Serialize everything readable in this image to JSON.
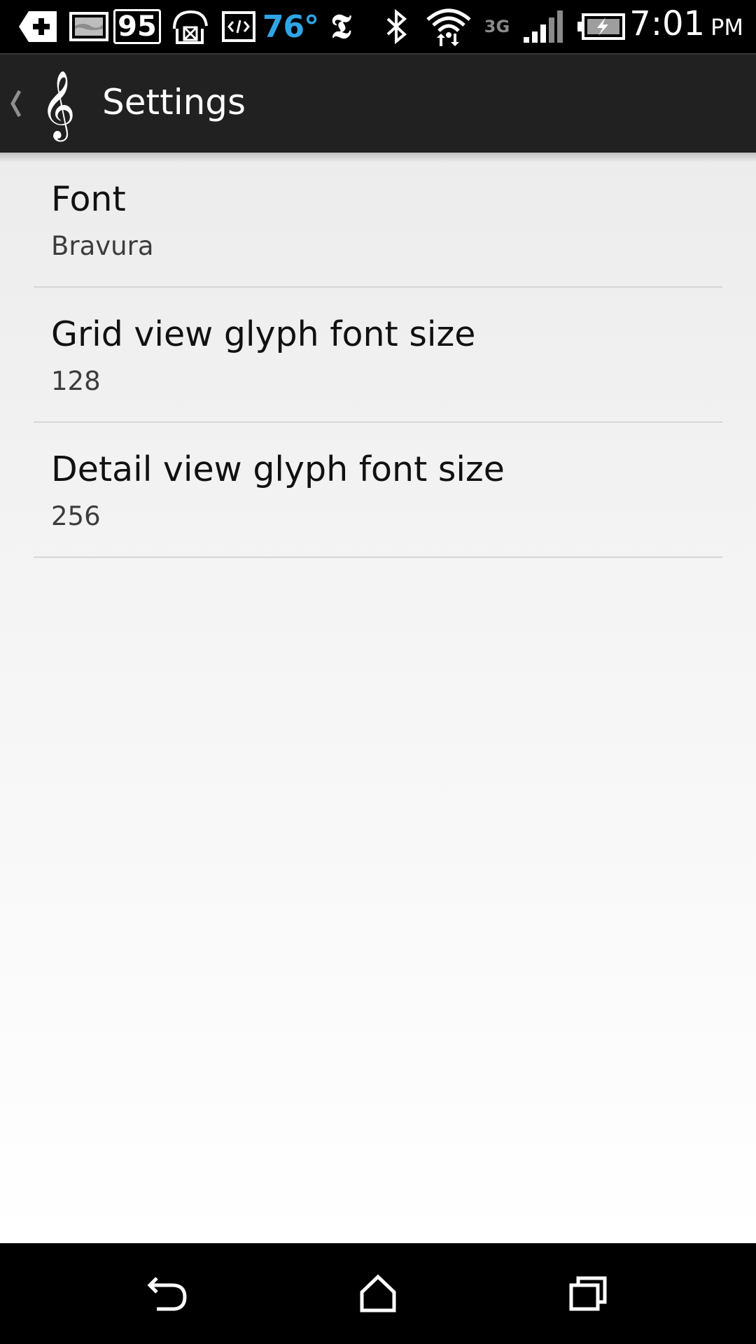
{
  "status_bar": {
    "icons": [
      "health-plus-icon",
      "photo-icon",
      "notification-count-badge",
      "image-download-icon",
      "code-icon",
      "temperature",
      "nytimes-icon",
      "bluetooth-icon",
      "wifi-icon",
      "network-type",
      "signal-icon",
      "battery-charging-icon"
    ],
    "notification_count": "95",
    "temperature": "76°",
    "network_type": "3G",
    "nytimes_glyph": "𝕿",
    "time": "7:01",
    "ampm": "PM",
    "temperature_color": "#2fa4e6"
  },
  "action_bar": {
    "title": "Settings",
    "app_icon": "treble-clef-icon",
    "up_icon": "chevron-left-icon",
    "app_glyph": "𝄞",
    "background_color": "#212121"
  },
  "preferences": [
    {
      "title": "Font",
      "summary": "Bravura"
    },
    {
      "title": "Grid view glyph font size",
      "summary": "128"
    },
    {
      "title": "Detail view glyph font size",
      "summary": "256"
    }
  ],
  "nav_bar": {
    "buttons": [
      "back-icon",
      "home-icon",
      "recents-icon"
    ]
  }
}
